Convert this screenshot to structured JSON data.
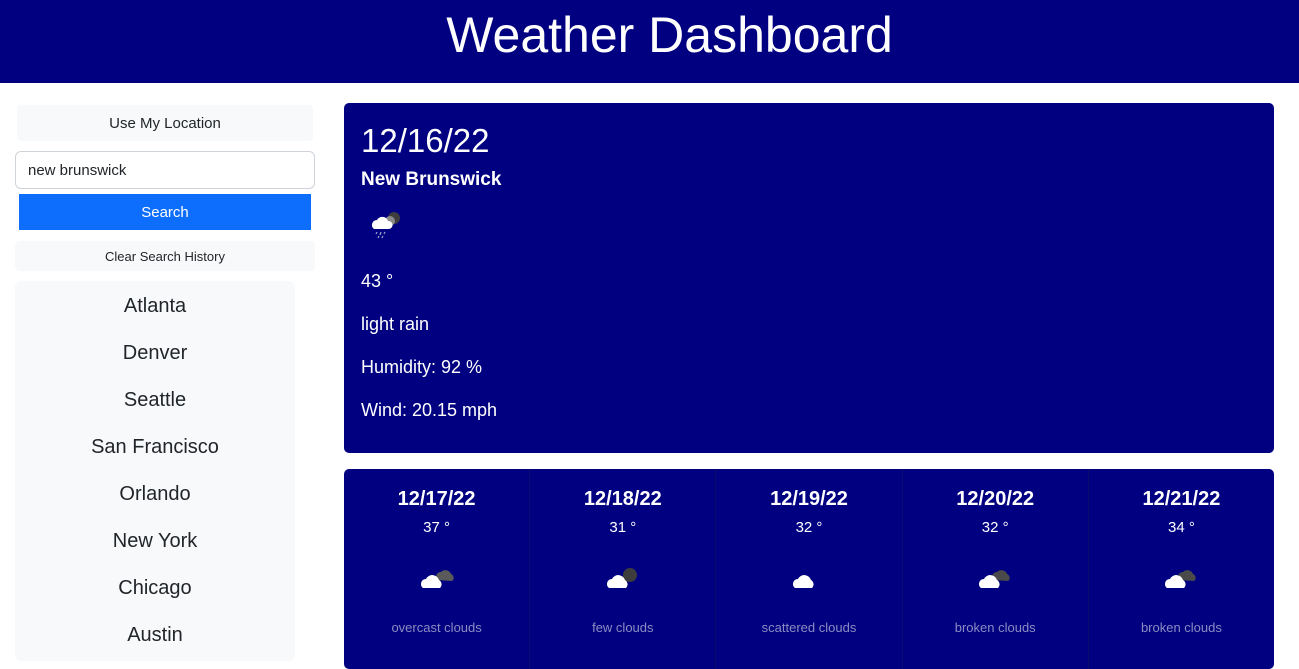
{
  "header": {
    "title": "Weather Dashboard"
  },
  "sidebar": {
    "location_button": "Use My Location",
    "search": {
      "value": "new brunswick",
      "button": "Search"
    },
    "clear_button": "Clear Search History",
    "history": [
      "Atlanta",
      "Denver",
      "Seattle",
      "San Francisco",
      "Orlando",
      "New York",
      "Chicago",
      "Austin"
    ]
  },
  "current": {
    "date": "12/16/22",
    "city": "New Brunswick",
    "icon": "rain-cloud-icon",
    "temp": "43 °",
    "description": "light rain",
    "humidity": "Humidity: 92 %",
    "wind": "Wind: 20.15 mph"
  },
  "forecast": [
    {
      "date": "12/17/22",
      "temp": "37 °",
      "icon": "overcast-clouds-icon",
      "description": "overcast clouds"
    },
    {
      "date": "12/18/22",
      "temp": "31 °",
      "icon": "few-clouds-icon",
      "description": "few clouds"
    },
    {
      "date": "12/19/22",
      "temp": "32 °",
      "icon": "scattered-clouds-icon",
      "description": "scattered clouds"
    },
    {
      "date": "12/20/22",
      "temp": "32 °",
      "icon": "broken-clouds-icon",
      "description": "broken clouds"
    },
    {
      "date": "12/21/22",
      "temp": "34 °",
      "icon": "broken-clouds-icon",
      "description": "broken clouds"
    }
  ],
  "colors": {
    "header_bg": "#000080",
    "card_bg": "#000080",
    "primary_button": "#0d6efd",
    "light_bg": "#f8f9fa"
  }
}
